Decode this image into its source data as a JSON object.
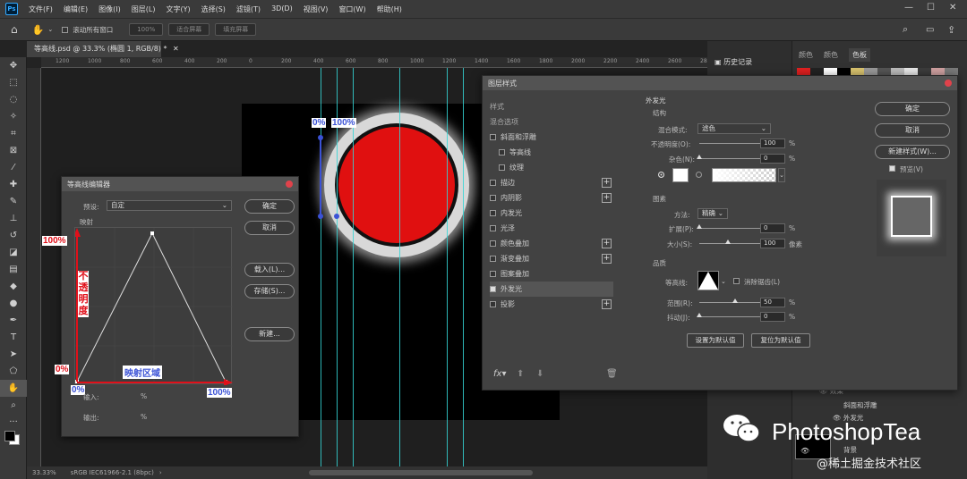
{
  "app": {
    "logo": "Ps",
    "menu": [
      "文件(F)",
      "编辑(E)",
      "图像(I)",
      "图层(L)",
      "文字(Y)",
      "选择(S)",
      "滤镜(T)",
      "3D(D)",
      "视图(V)",
      "窗口(W)",
      "帮助(H)"
    ]
  },
  "optionsbar": {
    "scroll_all": "滚动所有窗口",
    "zoom": "100%",
    "fit_screen": "适合屏幕",
    "fill_screen": "填充屏幕"
  },
  "document": {
    "tab_title": "等高线.psd @ 33.3% (椭圆 1, RGB/8) *",
    "zoom": "33.33%",
    "color_profile": "sRGB IEC61966-2.1 (8bpc)"
  },
  "ruler_ticks": [
    "1200",
    "1000",
    "800",
    "600",
    "400",
    "200",
    "0",
    "200",
    "400",
    "600",
    "800",
    "1000",
    "1200",
    "1400",
    "1600",
    "1800",
    "2000",
    "2200",
    "2400",
    "2600",
    "2800"
  ],
  "right_panel": {
    "history_tab": "历史记录",
    "tabs": [
      "颜色",
      "颜色",
      "色板"
    ],
    "layers": {
      "effects": "效果",
      "bevel": "斜面和浮雕",
      "outer_glow": "外发光",
      "background": "背景"
    }
  },
  "contour_editor": {
    "title": "等高线编辑器",
    "preset_label": "预设:",
    "preset_value": "自定",
    "mapping_label": "映射",
    "ok": "确定",
    "cancel": "取消",
    "load": "载入(L)...",
    "save": "存储(S)...",
    "new": "新建...",
    "input_label": "输入:",
    "input_unit": "%",
    "output_label": "输出:",
    "output_unit": "%"
  },
  "annotations": {
    "canvas_0": "0%",
    "canvas_100": "100%",
    "axis_y_100": "100%",
    "axis_y_0": "0%",
    "axis_x_0": "0%",
    "axis_x_100": "100%",
    "opacity_label": "不透明度",
    "mapping_region": "映射区域"
  },
  "layer_style": {
    "title": "图层样式",
    "list": [
      {
        "label": "样式",
        "check": false,
        "plus": false,
        "header": true
      },
      {
        "label": "混合选项",
        "check": false,
        "plus": false,
        "header": true
      },
      {
        "label": "斜面和浮雕",
        "check": true,
        "on": false,
        "plus": false
      },
      {
        "label": "等高线",
        "check": true,
        "on": false,
        "plus": false,
        "indent": true
      },
      {
        "label": "纹理",
        "check": true,
        "on": false,
        "plus": false,
        "indent": true
      },
      {
        "label": "描边",
        "check": true,
        "on": false,
        "plus": true
      },
      {
        "label": "内阴影",
        "check": true,
        "on": false,
        "plus": true
      },
      {
        "label": "内发光",
        "check": true,
        "on": false,
        "plus": false
      },
      {
        "label": "光泽",
        "check": true,
        "on": false,
        "plus": false
      },
      {
        "label": "颜色叠加",
        "check": true,
        "on": false,
        "plus": true
      },
      {
        "label": "渐变叠加",
        "check": true,
        "on": false,
        "plus": true
      },
      {
        "label": "图案叠加",
        "check": true,
        "on": false,
        "plus": false
      },
      {
        "label": "外发光",
        "check": true,
        "on": true,
        "plus": false,
        "selected": true
      },
      {
        "label": "投影",
        "check": true,
        "on": false,
        "plus": true
      }
    ],
    "section_title": "外发光",
    "structure": "结构",
    "blend_mode_label": "混合模式:",
    "blend_mode_value": "滤色",
    "opacity_label": "不透明度(O):",
    "opacity_value": "100",
    "opacity_level": 100,
    "noise_label": "杂色(N):",
    "noise_value": "0",
    "noise_level": 0,
    "elements": "图素",
    "method_label": "方法:",
    "method_value": "精确",
    "spread_label": "扩展(P):",
    "spread_value": "0",
    "spread_level": 0,
    "size_label": "大小(S):",
    "size_value": "100",
    "size_level": 40,
    "size_unit": "像素",
    "quality": "品质",
    "contour_label": "等高线:",
    "anti_alias": "消除锯齿(L)",
    "range_label": "范围(R):",
    "range_value": "50",
    "range_level": 50,
    "jitter_label": "抖动(J):",
    "jitter_value": "0",
    "jitter_level": 0,
    "percent": "%",
    "set_default": "设置为默认值",
    "reset_default": "复位为默认值",
    "ok": "确定",
    "cancel": "取消",
    "new_style": "新建样式(W)...",
    "preview": "预览(V)",
    "fx": "fx"
  },
  "watermark": {
    "brand": "PhotoshopTea",
    "site": "@稀土掘金技术社区"
  },
  "colors": {
    "circle": "#e01010",
    "guide": "#35d6d6",
    "annotation_blue": "#3b52d6",
    "annotation_red": "#e0101a"
  }
}
